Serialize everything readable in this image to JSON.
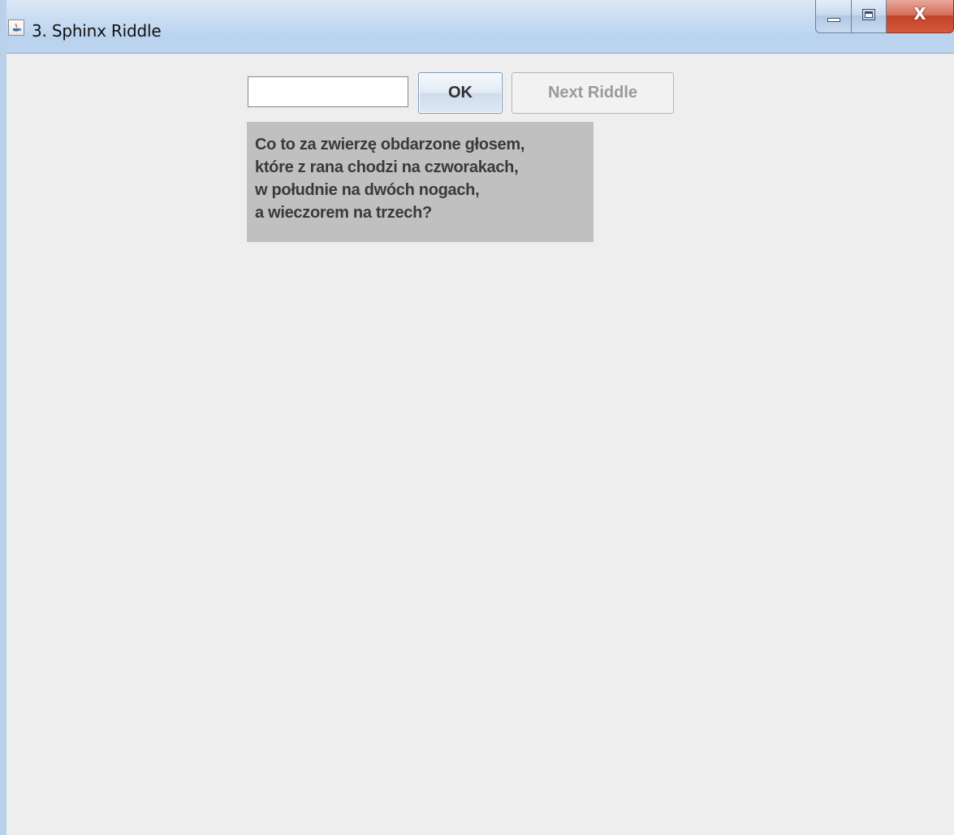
{
  "window": {
    "title": "3. Sphinx Riddle",
    "app_icon": "java-cup-icon",
    "controls": {
      "minimize": "minimize-icon",
      "maximize": "maximize-icon",
      "close": "X"
    }
  },
  "form": {
    "answer_value": "",
    "answer_placeholder": "",
    "ok_label": "OK",
    "next_label": "Next Riddle",
    "next_enabled": false
  },
  "riddle": {
    "lines": [
      "Co to za zwierzę obdarzone głosem,",
      "które z rana chodzi na czworakach,",
      "w południe na dwóch nogach,",
      "a wieczorem na trzech?"
    ]
  },
  "colors": {
    "background": "#eeeeee",
    "riddle_background": "#c0c0c0",
    "disabled_text": "#9a9a9a"
  }
}
